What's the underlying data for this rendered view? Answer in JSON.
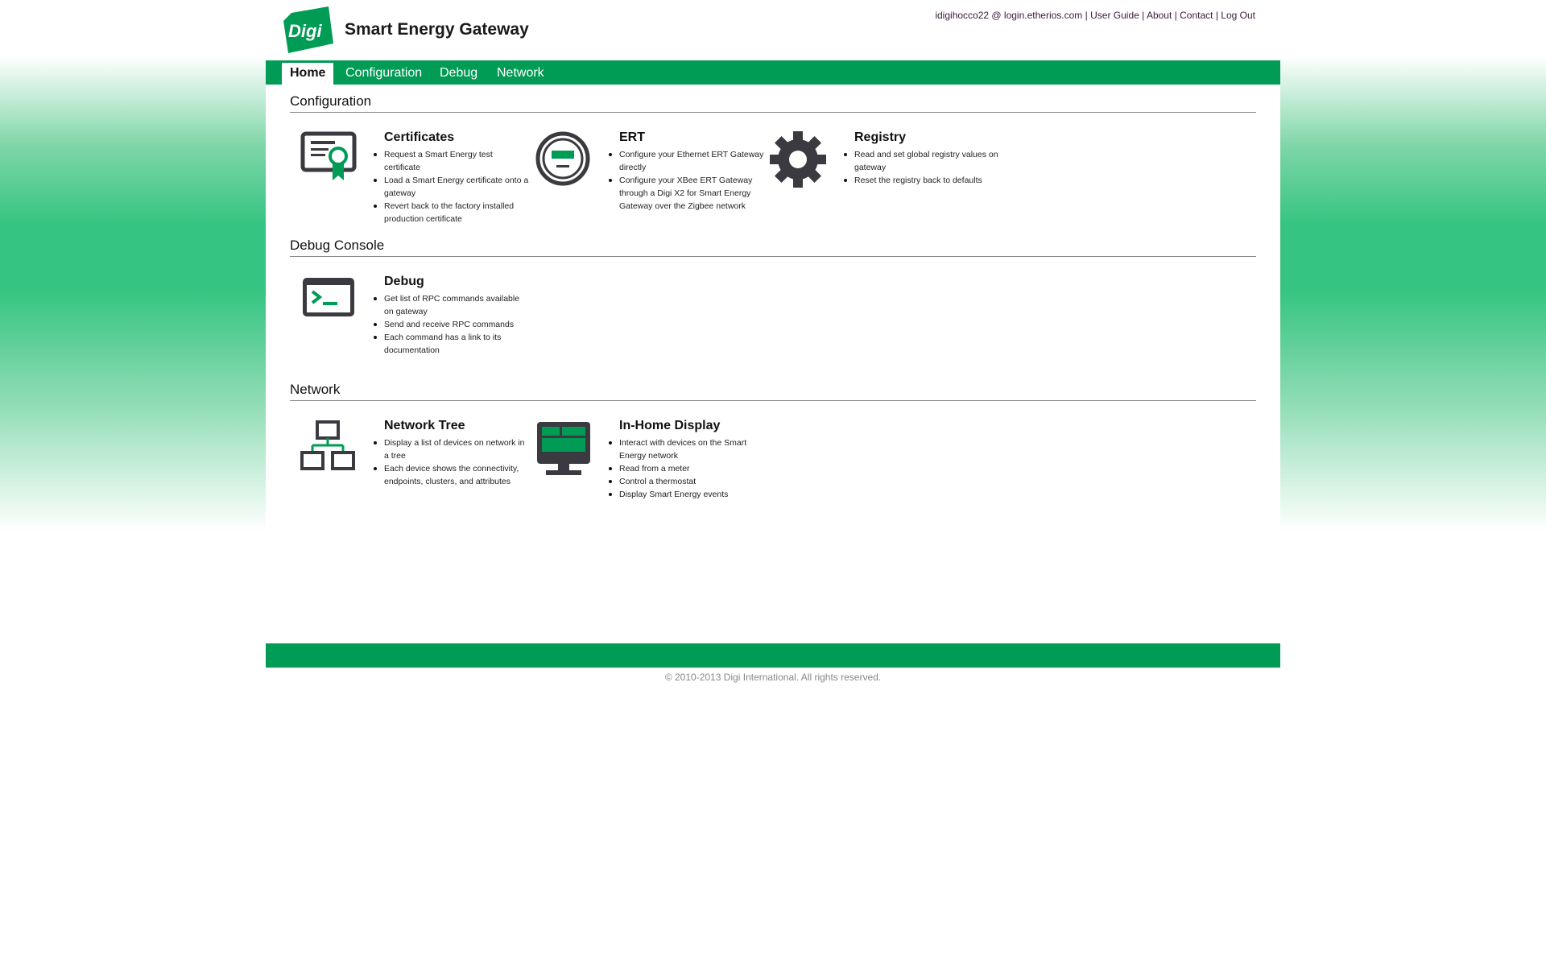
{
  "app": {
    "title": "Smart Energy Gateway",
    "logo_text": "Digi"
  },
  "toplinks": {
    "user": "idigihocco22 @ login.etherios.com",
    "user_guide": "User Guide",
    "about": "About",
    "contact": "Contact",
    "logout": "Log Out",
    "separator": "|"
  },
  "nav": {
    "tabs": [
      {
        "label": "Home",
        "active": true
      },
      {
        "label": "Configuration",
        "active": false
      },
      {
        "label": "Debug",
        "active": false
      },
      {
        "label": "Network",
        "active": false
      }
    ]
  },
  "sections": {
    "configuration": {
      "title": "Configuration",
      "cards": [
        {
          "title": "Certificates",
          "icon": "certificate-icon",
          "items": [
            "Request a Smart Energy test certificate",
            "Load a Smart Energy certificate onto a gateway",
            "Revert back to the factory installed production certificate"
          ]
        },
        {
          "title": "ERT",
          "icon": "meter-icon",
          "items": [
            "Configure your Ethernet ERT Gateway directly",
            "Configure your XBee ERT Gateway through a Digi X2 for Smart Energy Gateway over the Zigbee network"
          ]
        },
        {
          "title": "Registry",
          "icon": "gear-icon",
          "items": [
            "Read and set global registry values on gateway",
            "Reset the registry back to defaults"
          ]
        }
      ]
    },
    "debug": {
      "title": "Debug Console",
      "cards": [
        {
          "title": "Debug",
          "icon": "terminal-icon",
          "items": [
            "Get list of RPC commands available on gateway",
            "Send and receive RPC commands",
            "Each command has a link to its documentation"
          ]
        }
      ]
    },
    "network": {
      "title": "Network",
      "cards": [
        {
          "title": "Network Tree",
          "icon": "network-tree-icon",
          "items": [
            "Display a list of devices on network in a tree",
            "Each device shows the connectivity, endpoints, clusters, and attributes"
          ]
        },
        {
          "title": "In-Home Display",
          "icon": "monitor-icon",
          "items": [
            "Interact with devices on the Smart Energy network",
            "Read from a meter",
            "Control a thermostat",
            "Display Smart Energy events"
          ]
        }
      ]
    }
  },
  "footer": {
    "copyright": "© 2010-2013 Digi International. All rights reserved."
  },
  "colors": {
    "brand_green": "#009b54",
    "icon_dark": "#3a3a40"
  }
}
